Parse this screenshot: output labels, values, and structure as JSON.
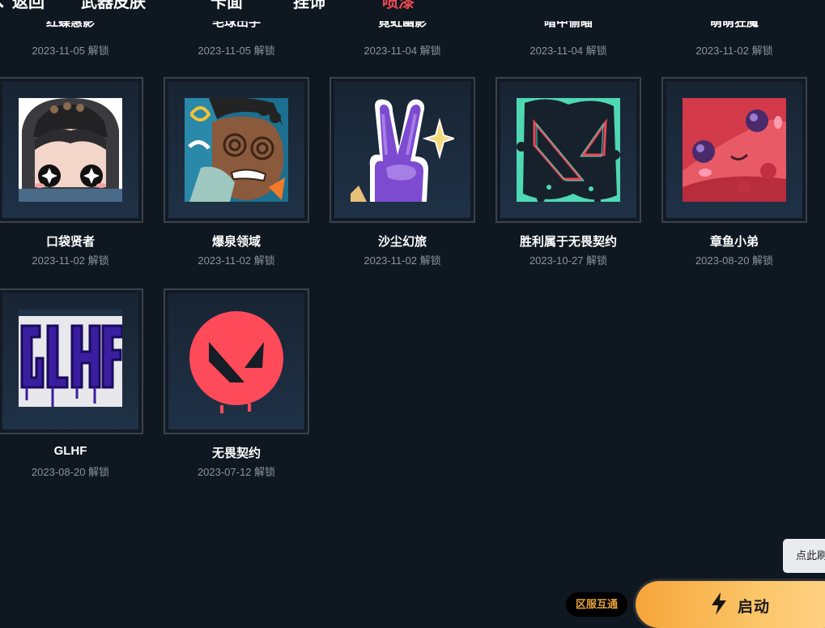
{
  "nav": {
    "back_label": "返回",
    "tabs": [
      {
        "label": "武器皮肤"
      },
      {
        "label": "卡面"
      },
      {
        "label": "挂饰"
      },
      {
        "label": "喷漆"
      }
    ]
  },
  "clipped_row": [
    {
      "name": "红蝶惠影",
      "date": "2023-11-05 解锁"
    },
    {
      "name": "毛球出手",
      "date": "2023-11-05 解锁"
    },
    {
      "name": "霓虹幽影",
      "date": "2023-11-04 解锁"
    },
    {
      "name": "暗中偷瞄",
      "date": "2023-11-04 解锁"
    },
    {
      "name": "萌萌狂魔",
      "date": "2023-11-02 解锁"
    }
  ],
  "sprays": [
    {
      "name": "口袋贤者",
      "date": "2023-11-02 解锁",
      "icon": "hooded-girl-icon"
    },
    {
      "name": "爆泉领域",
      "date": "2023-11-02 解锁",
      "icon": "dizzy-man-icon"
    },
    {
      "name": "沙尘幻旅",
      "date": "2023-11-02 解锁",
      "icon": "peace-hand-icon"
    },
    {
      "name": "胜利属于无畏契约",
      "date": "2023-10-27 解锁",
      "icon": "valorant-logo-splash-icon"
    },
    {
      "name": "章鱼小弟",
      "date": "2023-08-20 解锁",
      "icon": "octopus-icon"
    },
    {
      "name": "GLHF",
      "date": "2023-08-20 解锁",
      "icon": "glhf-graffiti-icon"
    },
    {
      "name": "无畏契约",
      "date": "2023-07-12 解锁",
      "icon": "valorant-red-logo-icon"
    }
  ],
  "controls": {
    "refresh_tip": "点此刷新",
    "region_badge": "区服互通",
    "launch_label": "启动"
  },
  "colors": {
    "background": "#0f1720",
    "active_tab": "#ef4a52",
    "launch_gradient_start": "#f6a53a",
    "launch_gradient_end": "#ffd489",
    "region_badge_text": "#e6a13a"
  }
}
